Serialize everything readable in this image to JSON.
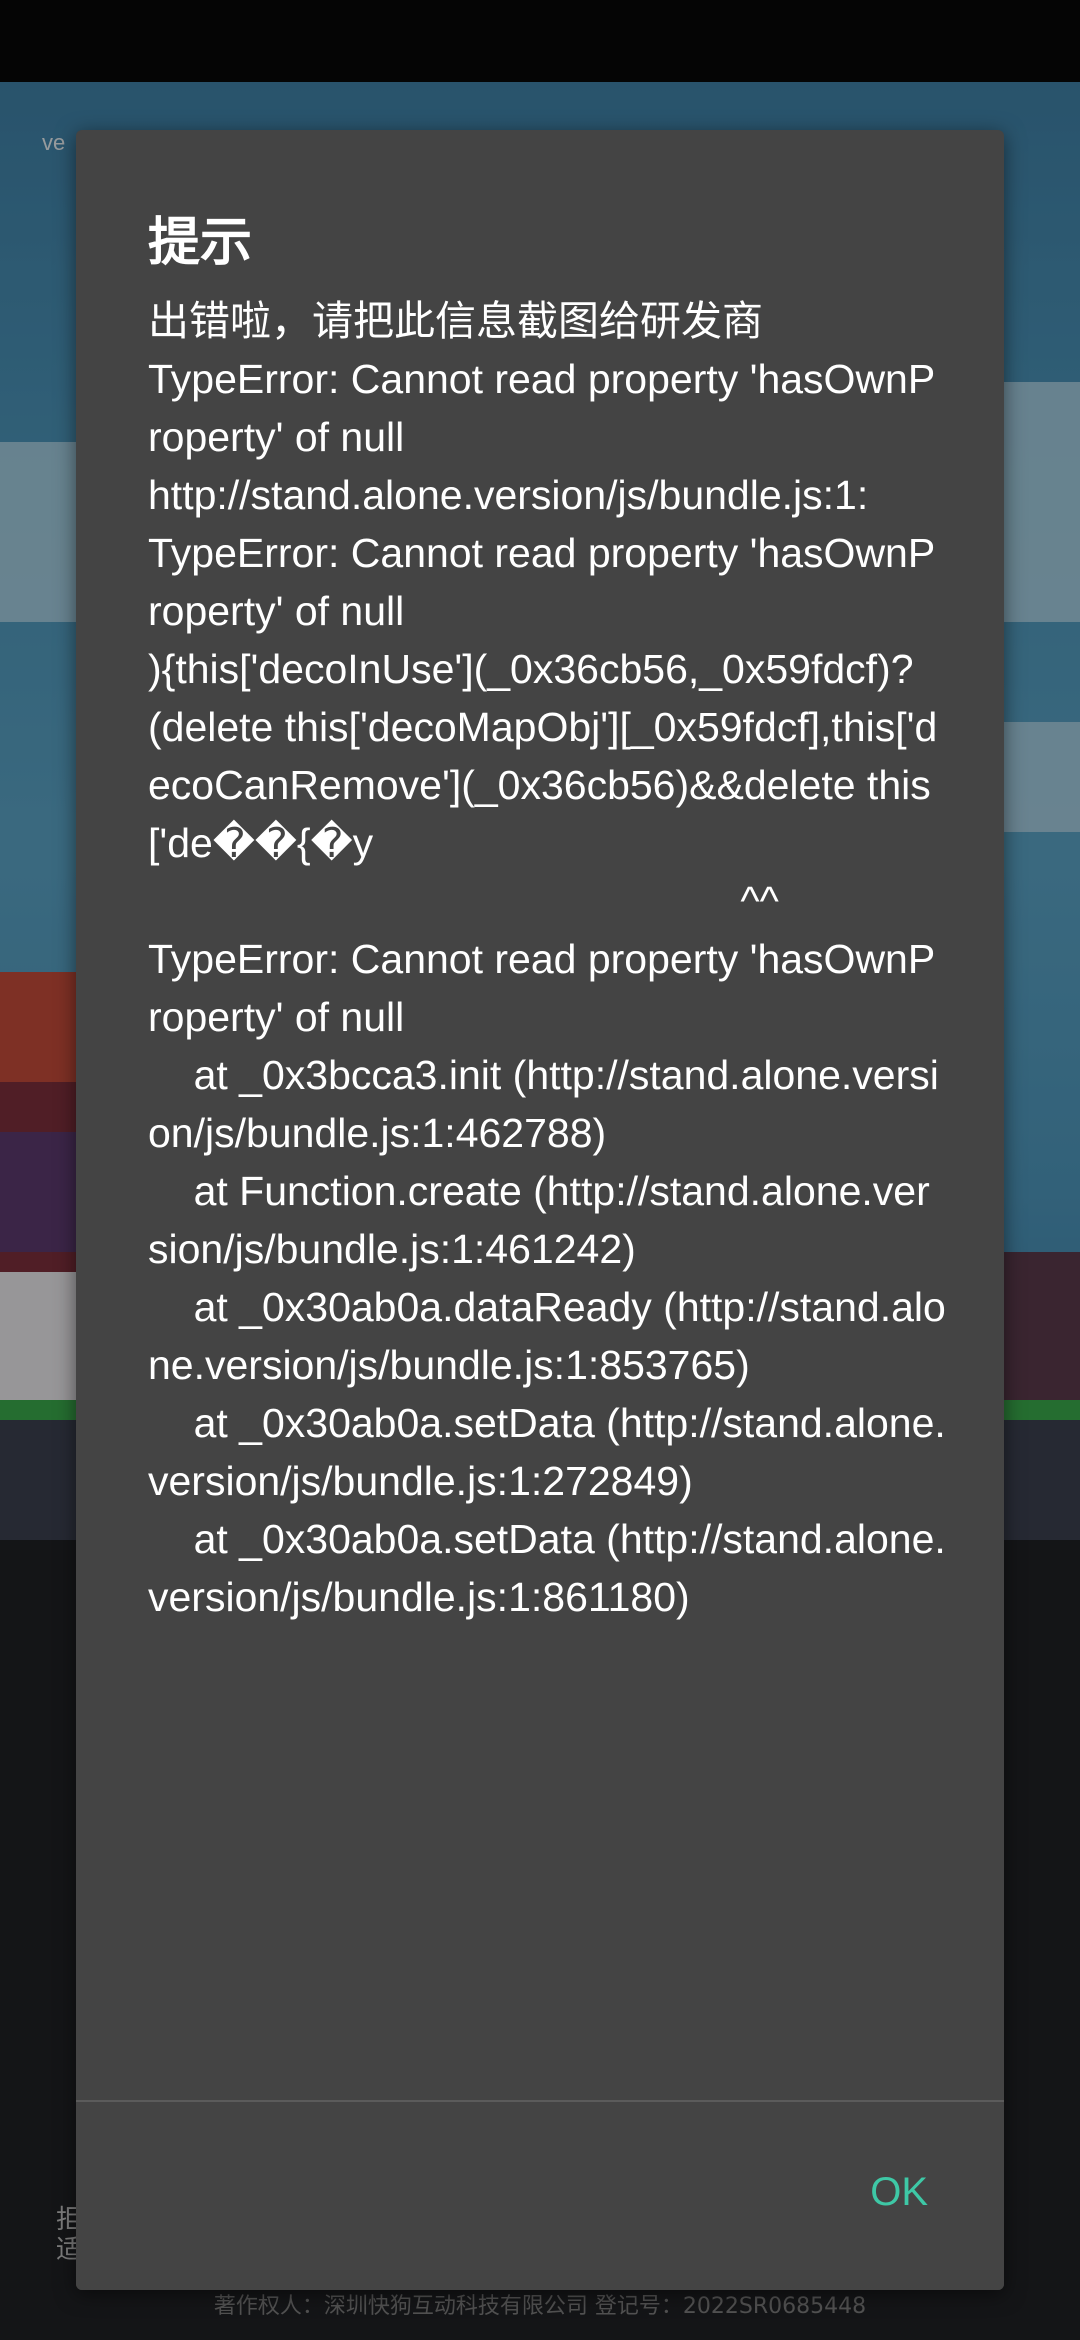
{
  "background": {
    "version_hint": "ve",
    "bottom_hint_line1": "拒",
    "bottom_hint_line2": "适",
    "copyright": "著作权人：深圳快狗互动科技有限公司    登记号：2022SR0685448"
  },
  "dialog": {
    "title": "提示",
    "message": "出错啦，请把此信息截图给研发商\nTypeError: Cannot read property 'hasOwnProperty' of null\nhttp://stand.alone.version/js/bundle.js:1:\nTypeError: Cannot read property 'hasOwnProperty' of null\n){this['decoInUse'](_0x36cb56,_0x59fdcf)?(delete this['decoMapObj'][_0x59fdcf],this['decoCanRemove'](_0x36cb56)&&delete this['de��{�y\n                                                    ^^\nTypeError: Cannot read property 'hasOwnProperty' of null\n    at _0x3bcca3.init (http://stand.alone.version/js/bundle.js:1:462788)\n    at Function.create (http://stand.alone.version/js/bundle.js:1:461242)\n    at _0x30ab0a.dataReady (http://stand.alone.version/js/bundle.js:1:853765)\n    at _0x30ab0a.setData (http://stand.alone.version/js/bundle.js:1:272849)\n    at _0x30ab0a.setData (http://stand.alone.version/js/bundle.js:1:861180)",
    "ok_label": "OK",
    "accent_color": "#3ec8a6"
  }
}
